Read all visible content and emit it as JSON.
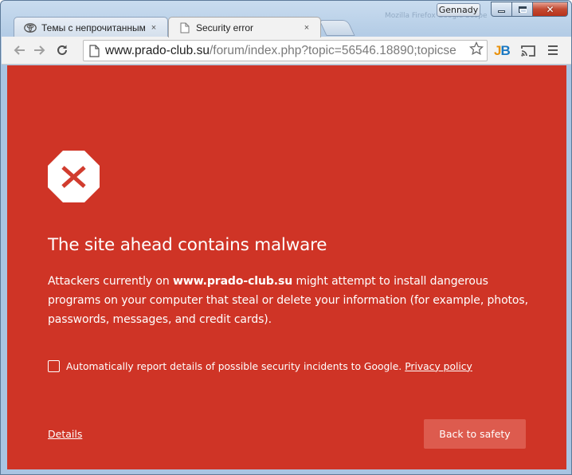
{
  "window": {
    "user_name": "Gennady",
    "background_text": "Mozilla Firefox Google Scope",
    "close_symbol": "✕",
    "accent_frame": "#b5cde6",
    "close_color": "#c44a32"
  },
  "tabs": [
    {
      "label": "Темы с непрочитанными",
      "icon": "toyota-logo-icon",
      "close": "×"
    },
    {
      "label": "Security error",
      "icon": "page-icon",
      "close": "×"
    }
  ],
  "toolbar": {
    "url_host": "www.prado-club.su",
    "url_path": "/forum/index.php?topic=56546.18890;topicse",
    "extension_j": "J",
    "extension_b": "B"
  },
  "interstitial": {
    "background_color": "#cf3426",
    "button_color": "#dd5b4e",
    "heading": "The site ahead contains malware",
    "para_prefix": "Attackers currently on ",
    "para_host": "www.prado-club.su",
    "para_suffix": " might attempt to install dangerous programs on your computer that steal or delete your information (for example, photos, passwords, messages, and credit cards).",
    "report_text": "Automatically report details of possible security incidents to Google.",
    "privacy_link": "Privacy policy",
    "report_checked": false,
    "details_link": "Details",
    "safety_button": "Back to safety"
  }
}
